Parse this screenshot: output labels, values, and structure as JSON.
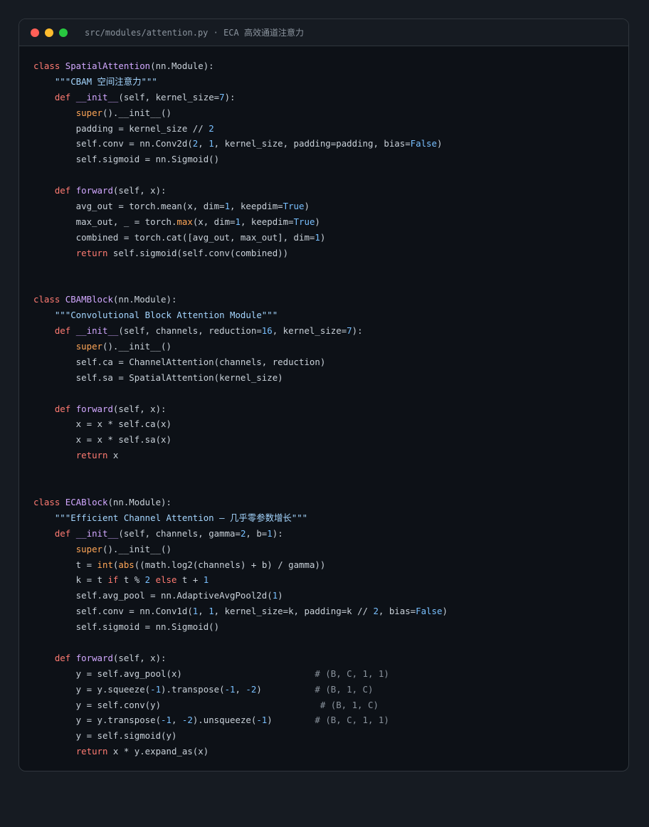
{
  "window": {
    "title": "src/modules/attention.py · ECA 高效通道注意力",
    "controls": [
      {
        "name": "close",
        "color": "#ff5f57"
      },
      {
        "name": "minimize",
        "color": "#febc2e"
      },
      {
        "name": "maximize",
        "color": "#28c840"
      }
    ]
  },
  "colors": {
    "keyword": "#ff7b72",
    "function": "#d2a8ff",
    "builtin": "#ffa657",
    "string": "#a5d6ff",
    "number": "#79c0ff",
    "comment": "#8b949e",
    "text": "#c9d1d9"
  },
  "code": {
    "lines": [
      [
        [
          "k",
          "class "
        ],
        [
          "f",
          "SpatialAttention"
        ],
        [
          "t",
          "(nn.Module):"
        ]
      ],
      [
        [
          "t",
          "    "
        ],
        [
          "s",
          "\"\"\"CBAM 空间注意力\"\"\""
        ]
      ],
      [
        [
          "t",
          "    "
        ],
        [
          "k",
          "def "
        ],
        [
          "f",
          "__init__"
        ],
        [
          "t",
          "(self, kernel_size="
        ],
        [
          "n",
          "7"
        ],
        [
          "t",
          "):"
        ]
      ],
      [
        [
          "t",
          "        "
        ],
        [
          "b",
          "super"
        ],
        [
          "t",
          "().__init__()"
        ]
      ],
      [
        [
          "t",
          "        padding = kernel_size // "
        ],
        [
          "n",
          "2"
        ]
      ],
      [
        [
          "t",
          "        self.conv = nn.Conv2d("
        ],
        [
          "n",
          "2"
        ],
        [
          "t",
          ", "
        ],
        [
          "n",
          "1"
        ],
        [
          "t",
          ", kernel_size, padding=padding, bias="
        ],
        [
          "n",
          "False"
        ],
        [
          "t",
          ")"
        ]
      ],
      [
        [
          "t",
          "        self.sigmoid = nn.Sigmoid()"
        ]
      ],
      [],
      [
        [
          "t",
          "    "
        ],
        [
          "k",
          "def "
        ],
        [
          "f",
          "forward"
        ],
        [
          "t",
          "(self, x):"
        ]
      ],
      [
        [
          "t",
          "        avg_out = torch.mean(x, dim="
        ],
        [
          "n",
          "1"
        ],
        [
          "t",
          ", keepdim="
        ],
        [
          "n",
          "True"
        ],
        [
          "t",
          ")"
        ]
      ],
      [
        [
          "t",
          "        max_out, _ = torch."
        ],
        [
          "b",
          "max"
        ],
        [
          "t",
          "(x, dim="
        ],
        [
          "n",
          "1"
        ],
        [
          "t",
          ", keepdim="
        ],
        [
          "n",
          "True"
        ],
        [
          "t",
          ")"
        ]
      ],
      [
        [
          "t",
          "        combined = torch.cat([avg_out, max_out], dim="
        ],
        [
          "n",
          "1"
        ],
        [
          "t",
          ")"
        ]
      ],
      [
        [
          "t",
          "        "
        ],
        [
          "k",
          "return "
        ],
        [
          "t",
          "self.sigmoid(self.conv(combined))"
        ]
      ],
      [],
      [],
      [
        [
          "k",
          "class "
        ],
        [
          "f",
          "CBAMBlock"
        ],
        [
          "t",
          "(nn.Module):"
        ]
      ],
      [
        [
          "t",
          "    "
        ],
        [
          "s",
          "\"\"\"Convolutional Block Attention Module\"\"\""
        ]
      ],
      [
        [
          "t",
          "    "
        ],
        [
          "k",
          "def "
        ],
        [
          "f",
          "__init__"
        ],
        [
          "t",
          "(self, channels, reduction="
        ],
        [
          "n",
          "16"
        ],
        [
          "t",
          ", kernel_size="
        ],
        [
          "n",
          "7"
        ],
        [
          "t",
          "):"
        ]
      ],
      [
        [
          "t",
          "        "
        ],
        [
          "b",
          "super"
        ],
        [
          "t",
          "().__init__()"
        ]
      ],
      [
        [
          "t",
          "        self.ca = ChannelAttention(channels, reduction)"
        ]
      ],
      [
        [
          "t",
          "        self.sa = SpatialAttention(kernel_size)"
        ]
      ],
      [],
      [
        [
          "t",
          "    "
        ],
        [
          "k",
          "def "
        ],
        [
          "f",
          "forward"
        ],
        [
          "t",
          "(self, x):"
        ]
      ],
      [
        [
          "t",
          "        x = x * self.ca(x)"
        ]
      ],
      [
        [
          "t",
          "        x = x * self.sa(x)"
        ]
      ],
      [
        [
          "t",
          "        "
        ],
        [
          "k",
          "return "
        ],
        [
          "t",
          "x"
        ]
      ],
      [],
      [],
      [
        [
          "k",
          "class "
        ],
        [
          "f",
          "ECABlock"
        ],
        [
          "t",
          "(nn.Module):"
        ]
      ],
      [
        [
          "t",
          "    "
        ],
        [
          "s",
          "\"\"\"Efficient Channel Attention — 几乎零参数增长\"\"\""
        ]
      ],
      [
        [
          "t",
          "    "
        ],
        [
          "k",
          "def "
        ],
        [
          "f",
          "__init__"
        ],
        [
          "t",
          "(self, channels, gamma="
        ],
        [
          "n",
          "2"
        ],
        [
          "t",
          ", b="
        ],
        [
          "n",
          "1"
        ],
        [
          "t",
          "):"
        ]
      ],
      [
        [
          "t",
          "        "
        ],
        [
          "b",
          "super"
        ],
        [
          "t",
          "().__init__()"
        ]
      ],
      [
        [
          "t",
          "        t = "
        ],
        [
          "b",
          "int"
        ],
        [
          "t",
          "("
        ],
        [
          "b",
          "abs"
        ],
        [
          "t",
          "((math.log2(channels) + b) / gamma))"
        ]
      ],
      [
        [
          "t",
          "        k = t "
        ],
        [
          "k",
          "if "
        ],
        [
          "t",
          "t % "
        ],
        [
          "n",
          "2"
        ],
        [
          "t",
          " "
        ],
        [
          "k",
          "else "
        ],
        [
          "t",
          "t + "
        ],
        [
          "n",
          "1"
        ]
      ],
      [
        [
          "t",
          "        self.avg_pool = nn.AdaptiveAvgPool2d("
        ],
        [
          "n",
          "1"
        ],
        [
          "t",
          ")"
        ]
      ],
      [
        [
          "t",
          "        self.conv = nn.Conv1d("
        ],
        [
          "n",
          "1"
        ],
        [
          "t",
          ", "
        ],
        [
          "n",
          "1"
        ],
        [
          "t",
          ", kernel_size=k, padding=k // "
        ],
        [
          "n",
          "2"
        ],
        [
          "t",
          ", bias="
        ],
        [
          "n",
          "False"
        ],
        [
          "t",
          ")"
        ]
      ],
      [
        [
          "t",
          "        self.sigmoid = nn.Sigmoid()"
        ]
      ],
      [],
      [
        [
          "t",
          "    "
        ],
        [
          "k",
          "def "
        ],
        [
          "f",
          "forward"
        ],
        [
          "t",
          "(self, x):"
        ]
      ],
      [
        [
          "t",
          "        y = self.avg_pool(x)                         "
        ],
        [
          "c",
          "# (B, C, 1, 1)"
        ]
      ],
      [
        [
          "t",
          "        y = y.squeeze("
        ],
        [
          "n",
          "-1"
        ],
        [
          "t",
          ").transpose("
        ],
        [
          "n",
          "-1"
        ],
        [
          "t",
          ", "
        ],
        [
          "n",
          "-2"
        ],
        [
          "t",
          ")          "
        ],
        [
          "c",
          "# (B, 1, C)"
        ]
      ],
      [
        [
          "t",
          "        y = self.conv(y)                              "
        ],
        [
          "c",
          "# (B, 1, C)"
        ]
      ],
      [
        [
          "t",
          "        y = y.transpose("
        ],
        [
          "n",
          "-1"
        ],
        [
          "t",
          ", "
        ],
        [
          "n",
          "-2"
        ],
        [
          "t",
          ").unsqueeze("
        ],
        [
          "n",
          "-1"
        ],
        [
          "t",
          ")        "
        ],
        [
          "c",
          "# (B, C, 1, 1)"
        ]
      ],
      [
        [
          "t",
          "        y = self.sigmoid(y)"
        ]
      ],
      [
        [
          "t",
          "        "
        ],
        [
          "k",
          "return "
        ],
        [
          "t",
          "x * y.expand_as(x)"
        ]
      ]
    ]
  }
}
